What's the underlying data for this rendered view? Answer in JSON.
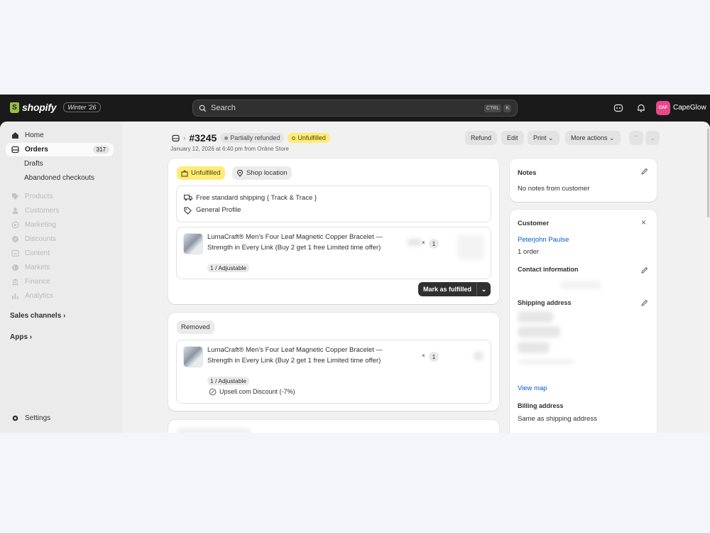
{
  "topbar": {
    "brand": "shopify",
    "brand_badge": "S",
    "edition": "Winter '26",
    "search_placeholder": "Search",
    "shortcut": [
      "CTRL",
      "K"
    ],
    "store_initials": "CAF",
    "store_name": "CapeGlow"
  },
  "sidebar": {
    "items": [
      {
        "label": "Home",
        "icon": "home-icon"
      },
      {
        "label": "Orders",
        "icon": "orders-icon",
        "count": "317"
      },
      {
        "label": "Drafts"
      },
      {
        "label": "Abandoned checkouts"
      },
      {
        "label": "Products",
        "icon": "tag-icon"
      },
      {
        "label": "Customers",
        "icon": "person-icon"
      },
      {
        "label": "Marketing",
        "icon": "target-icon"
      },
      {
        "label": "Discounts",
        "icon": "discount-icon"
      },
      {
        "label": "Content",
        "icon": "content-icon"
      },
      {
        "label": "Markets",
        "icon": "globe-icon"
      },
      {
        "label": "Finance",
        "icon": "bank-icon"
      },
      {
        "label": "Analytics",
        "icon": "chart-icon"
      }
    ],
    "sales_channels": "Sales channels",
    "apps": "Apps",
    "settings": "Settings"
  },
  "order": {
    "number": "#3245",
    "payment_status": "Partially refunded",
    "fulfillment_status": "Unfulfilled",
    "date": "January 12, 2026 at 6:40 pm from Online Store",
    "actions": {
      "refund": "Refund",
      "edit": "Edit",
      "print": "Print",
      "more": "More actions"
    }
  },
  "fulfillment_card": {
    "status": "Unfulfilled",
    "location": "Shop location",
    "shipping_method": "Free standard shipping { Track & Trace }",
    "profile": "General Profile",
    "item": {
      "title": "LumaCraft® Men's Four Leaf Magnetic Copper Bracelet — Strength in Every Link (Buy 2 get 1 free Limited time offer)",
      "variant": "1 / Adjustable",
      "times": "×",
      "quantity": "1"
    },
    "mark_fulfilled": "Mark as fulfilled"
  },
  "removed_card": {
    "status": "Removed",
    "item": {
      "title": "LumaCraft® Men's Four Leaf Magnetic Copper Bracelet — Strength in Every Link (Buy 2 get 1 free Limited time offer)",
      "variant": "1 / Adjustable",
      "times": "×",
      "quantity": "1",
      "discount": "Upsell.com Discount (-7%)"
    }
  },
  "notes": {
    "title": "Notes",
    "body": "No notes from customer"
  },
  "customer": {
    "title": "Customer",
    "name": "Peterjohn Paulse",
    "orders": "1 order",
    "contact_title": "Contact information",
    "shipping_title": "Shipping address",
    "view_map": "View map",
    "billing_title": "Billing address",
    "billing_body": "Same as shipping address"
  },
  "colors": {
    "accent_yellow": "#ffeb78",
    "topbar": "#1a1a1a",
    "link": "#005bd3"
  }
}
